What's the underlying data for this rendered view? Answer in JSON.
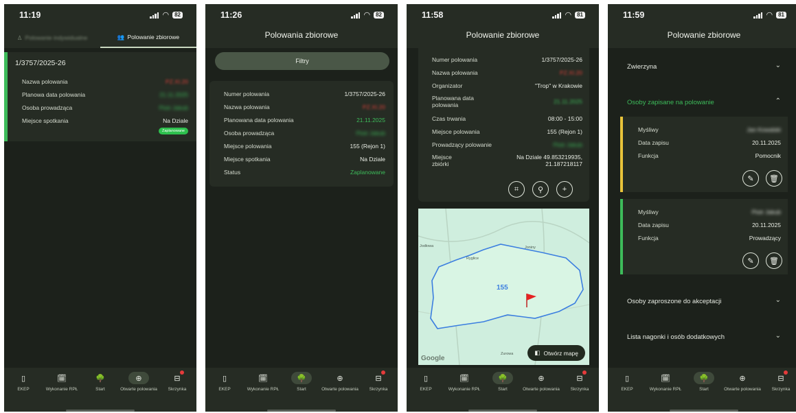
{
  "screens": [
    {
      "time": "11:19",
      "battery": "82",
      "tabs": [
        {
          "label": "Polowanie indywidualne",
          "active": false
        },
        {
          "label": "Polowanie zbiorowe",
          "active": true
        }
      ],
      "card": {
        "number": "1/3757/2025-26",
        "rows": [
          {
            "label": "Nazwa polowania",
            "value": "PZ.XI.20"
          },
          {
            "label": "Planowa data polowania",
            "value": "21.11.2025"
          },
          {
            "label": "Osoba prowadząca",
            "value": "Piotr Jakub"
          },
          {
            "label": "Miejsce spotkania",
            "value": "Na Dziale"
          }
        ],
        "badge": "Zaplanowane"
      }
    },
    {
      "time": "11:26",
      "battery": "82",
      "title": "Polowania zbiorowe",
      "filter_label": "Filtry",
      "rows": [
        {
          "label": "Numer polowania",
          "value": "1/3757/2025-26"
        },
        {
          "label": "Nazwa polowania",
          "value": "PZ.XI.20"
        },
        {
          "label": "Planowana data polowania",
          "value": "21.11.2025"
        },
        {
          "label": "Osoba prowadząca",
          "value": "Piotr Jakub"
        },
        {
          "label": "Miejsce polowania",
          "value": "155 (Rejon 1)"
        },
        {
          "label": "Miejsce spotkania",
          "value": "Na Dziale"
        },
        {
          "label": "Status",
          "value": "Zaplanowane"
        }
      ]
    },
    {
      "time": "11:58",
      "battery": "81",
      "title": "Polowanie zbiorowe",
      "rows": [
        {
          "label": "Numer polowania",
          "value": "1/3757/2025-26"
        },
        {
          "label": "Nazwa polowania",
          "value": "PZ.XI.20"
        },
        {
          "label": "Organizator",
          "value": "\"Trop\" w Krakowie"
        },
        {
          "label": "Planowana data polowania",
          "value": "21.11.2025"
        },
        {
          "label": "Czas trwania",
          "value": "08:00 - 15:00"
        },
        {
          "label": "Miejsce polowania",
          "value": "155 (Rejon 1)"
        },
        {
          "label": "Prowadzący polowanie",
          "value": "Piotr Jakub"
        },
        {
          "label": "Miejsce zbiórki",
          "value": "Na Dziale 49.853219935, 21.187218117"
        }
      ],
      "map": {
        "area_label": "155",
        "places": [
          "Jodłowa",
          "Ryglice",
          "Joniny",
          "Zurowa"
        ],
        "provider": "Google",
        "open_label": "Otwórz mapę"
      }
    },
    {
      "time": "11:59",
      "battery": "81",
      "title": "Polowanie zbiorowe",
      "sections": {
        "animals": "Zwierzyna",
        "enrolled": "Osoby zapisane na polowanie",
        "invited": "Osoby zaproszone do akceptacji",
        "beaters": "Lista nagonki i osób dodatkowych"
      },
      "persons": [
        {
          "hunter_label": "Myśliwy",
          "hunter": "Jan Kowalski",
          "date_label": "Data zapisu",
          "date": "20.11.2025",
          "role_label": "Funkcja",
          "role": "Pomocnik",
          "accent": "#e8c33a"
        },
        {
          "hunter_label": "Myśliwy",
          "hunter": "Piotr Jakub",
          "date_label": "Data zapisu",
          "date": "20.11.2025",
          "role_label": "Funkcja",
          "role": "Prowadzący",
          "accent": "#3dbb5a"
        }
      ]
    }
  ],
  "nav": [
    {
      "label": "EKEP",
      "icon": "book-icon"
    },
    {
      "label": "Wykonanie RPŁ",
      "icon": "calendar-check-icon"
    },
    {
      "label": "Start",
      "icon": "tree-icon"
    },
    {
      "label": "Otwarte polowania",
      "icon": "crosshair-icon"
    },
    {
      "label": "Skrzynka",
      "icon": "inbox-icon"
    }
  ],
  "colors": {
    "background": "#1c211b",
    "surface": "#262c24",
    "accent_green": "#3dbb5a",
    "accent_red": "#e0403a",
    "accent_yellow": "#e8c33a"
  }
}
